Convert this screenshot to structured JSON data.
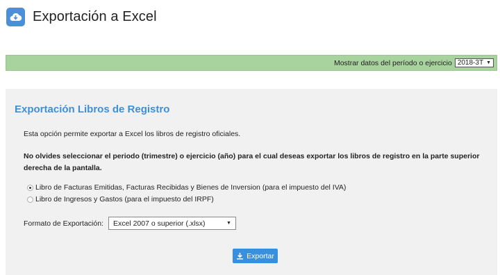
{
  "header": {
    "title": "Exportación a Excel",
    "icon": "cloud-download-icon"
  },
  "period_bar": {
    "label": "Mostrar datos del período o ejercicio",
    "selected": "2018-3T"
  },
  "panel": {
    "title": "Exportación Libros de Registro",
    "intro": "Esta opción permite exportar a Excel los libros de registro oficiales.",
    "warning": "No olvides seleccionar el periodo (trimestre) o ejercicio (año) para el cual deseas exportar los libros de registro en la parte superior derecha de la pantalla.",
    "options": [
      {
        "label": "Libro de Facturas Emitidas, Facturas Recibidas y Bienes de Inversion (para el impuesto del IVA)",
        "checked": true
      },
      {
        "label": "Libro de Ingresos y Gastos (para el impuesto del IRPF)",
        "checked": false
      }
    ],
    "format_label": "Formato de Exportación:",
    "format_selected": "Excel 2007 o superior (.xlsx)",
    "export_button": "Exportar"
  },
  "colors": {
    "accent": "#3e8fd6",
    "period_bar": "#a9d39e",
    "panel_bg": "#f1f1f1",
    "button": "#3a8fdd"
  }
}
